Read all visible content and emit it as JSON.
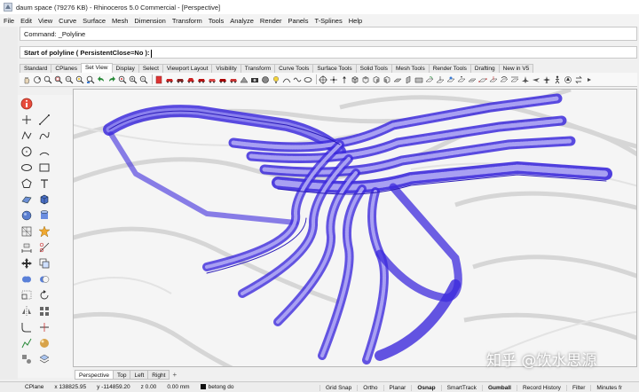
{
  "window": {
    "title": "daum space (79276 KB) - Rhinoceros 5.0 Commercial - [Perspective]"
  },
  "menu": [
    "File",
    "Edit",
    "View",
    "Curve",
    "Surface",
    "Mesh",
    "Dimension",
    "Transform",
    "Tools",
    "Analyze",
    "Render",
    "Panels",
    "T-Splines",
    "Help"
  ],
  "command": {
    "history": "Command: _Polyline",
    "prompt": "Start of polyline ( PersistentClose=No ):"
  },
  "toolbar_tabs": [
    "Standard",
    "CPlanes",
    "Set View",
    "Display",
    "Select",
    "Viewport Layout",
    "Visibility",
    "Transform",
    "Curve Tools",
    "Surface Tools",
    "Solid Tools",
    "Mesh Tools",
    "Render Tools",
    "Drafting",
    "New in V5"
  ],
  "active_toolbar_tab": "Set View",
  "viewport_tabs": [
    "Perspective",
    "Top",
    "Left",
    "Right"
  ],
  "active_viewport_tab": "Perspective",
  "viewport_add_tab": "+",
  "status": {
    "cplane": "CPlane",
    "x": "x 138825.95",
    "y": "y -114859.20",
    "z": "z 0.00",
    "units": "0.00 mm",
    "layer": "betong do",
    "toggles": [
      "Grid Snap",
      "Ortho",
      "Planar",
      "Osnap",
      "SmartTrack",
      "Gumball",
      "Record History",
      "Filter",
      "Minutes fr"
    ]
  },
  "watermark": {
    "text": "知乎 @饮水思源"
  },
  "colors": {
    "wireframe": "#3d2bdc",
    "viewport_bg": "#f5f5f5"
  }
}
